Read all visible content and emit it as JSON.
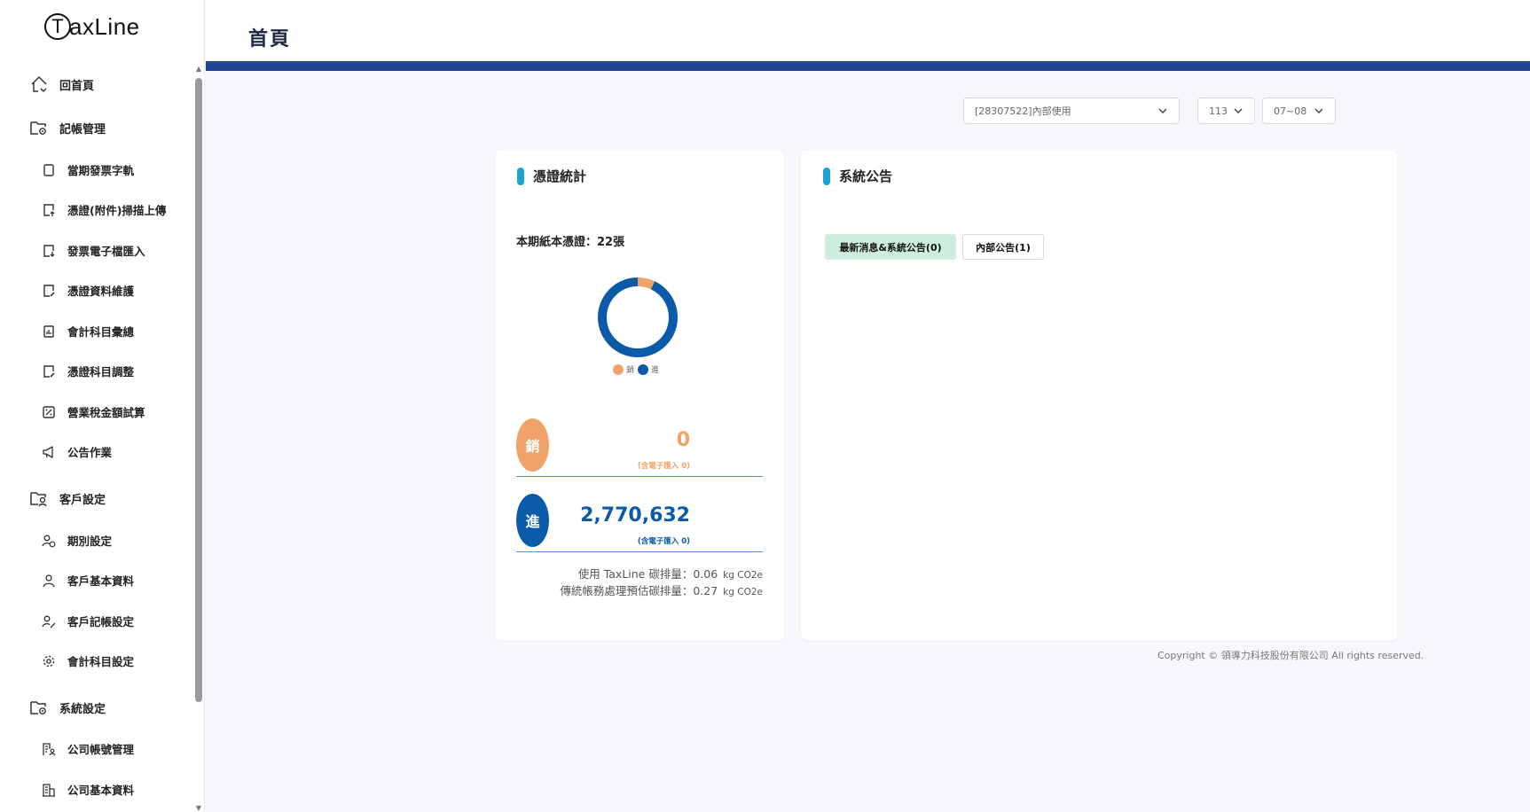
{
  "app": {
    "logo_letter": "T",
    "logo_text": "axLine"
  },
  "header": {
    "title": "首頁"
  },
  "sidebar": {
    "items": [
      {
        "label": "回首頁",
        "icon": "home-icon",
        "level": "top"
      },
      {
        "label": "記帳管理",
        "icon": "folder-settings-icon",
        "level": "top"
      },
      {
        "label": "當期發票字軌",
        "icon": "book-icon",
        "level": "sub"
      },
      {
        "label": "憑證(附件)掃描上傳",
        "icon": "upload-doc-icon",
        "level": "sub"
      },
      {
        "label": "發票電子檔匯入",
        "icon": "import-doc-icon",
        "level": "sub"
      },
      {
        "label": "憑證資料維護",
        "icon": "edit-doc-icon",
        "level": "sub"
      },
      {
        "label": "會計科目彙總",
        "icon": "chart-doc-icon",
        "level": "sub"
      },
      {
        "label": "憑證科目調整",
        "icon": "edit-doc-icon",
        "level": "sub"
      },
      {
        "label": "營業稅金額試算",
        "icon": "percent-icon",
        "level": "sub"
      },
      {
        "label": "公告作業",
        "icon": "megaphone-icon",
        "level": "sub"
      },
      {
        "label": "客戶設定",
        "icon": "folder-user-icon",
        "level": "top"
      },
      {
        "label": "期別設定",
        "icon": "user-clock-icon",
        "level": "sub"
      },
      {
        "label": "客戶基本資料",
        "icon": "user-icon",
        "level": "sub"
      },
      {
        "label": "客戶記帳設定",
        "icon": "user-edit-icon",
        "level": "sub"
      },
      {
        "label": "會計科目設定",
        "icon": "gear-icon",
        "level": "sub"
      },
      {
        "label": "系統設定",
        "icon": "folder-settings-icon",
        "level": "top"
      },
      {
        "label": "公司帳號管理",
        "icon": "building-user-icon",
        "level": "sub"
      },
      {
        "label": "公司基本資料",
        "icon": "building-icon",
        "level": "sub"
      }
    ]
  },
  "filters": {
    "company": "[28307522]內部使用",
    "year": "113",
    "period": "07~08"
  },
  "voucher_stats": {
    "title": "憑證統計",
    "paper_count": "本期紙本憑證：22張",
    "legend": [
      {
        "label": "銷",
        "color": "#f0a368"
      },
      {
        "label": "進",
        "color": "#0b5ba8"
      }
    ],
    "sales": {
      "badge": "銷",
      "amount": "0",
      "note": "(含電子匯入 0)",
      "color": "#f0a368"
    },
    "purchase": {
      "badge": "進",
      "amount": "2,770,632",
      "note": "(含電子匯入 0)",
      "color": "#0b5ba8"
    },
    "carbon": [
      {
        "label": "使用 TaxLine 碳排量：0.06",
        "unit": "kg CO2e"
      },
      {
        "label": "傳統帳務處理預估碳排量：0.27",
        "unit": "kg CO2e"
      }
    ]
  },
  "chart_data": {
    "type": "pie",
    "categories": [
      "銷",
      "進"
    ],
    "values": [
      0.07,
      0.93
    ],
    "colors": [
      "#f0a368",
      "#0b5ba8"
    ]
  },
  "announcements": {
    "title": "系統公告",
    "tabs": [
      {
        "label": "最新消息&系統公告(0)",
        "active": true
      },
      {
        "label": "內部公告(1)",
        "active": false
      }
    ]
  },
  "footer": {
    "copyright": "Copyright © 領導力科技股份有限公司 All rights reserved."
  },
  "colors": {
    "accent_bar": "#1f4591",
    "pill": "#1ba3d6",
    "tab_active": "#cdeede"
  }
}
